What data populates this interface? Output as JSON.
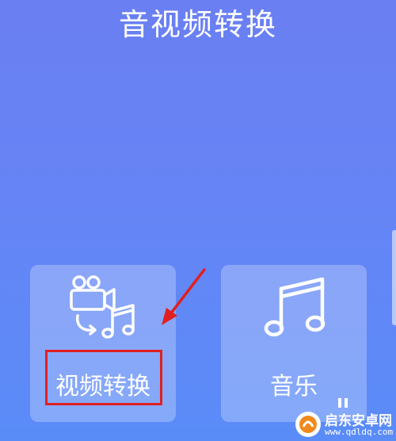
{
  "header": {
    "title": "音视频转换"
  },
  "cards": [
    {
      "label": "视频转换",
      "icon": "video-to-audio-icon",
      "highlighted": true
    },
    {
      "label": "音乐",
      "icon": "music-note-icon"
    }
  ],
  "annotation": {
    "highlight_color": "#e02020"
  },
  "colors": {
    "background": "#6684f5",
    "card": "rgba(255,255,255,0.26)"
  },
  "watermark": {
    "name": "启东安卓网",
    "url": "www.qdldq.com"
  }
}
